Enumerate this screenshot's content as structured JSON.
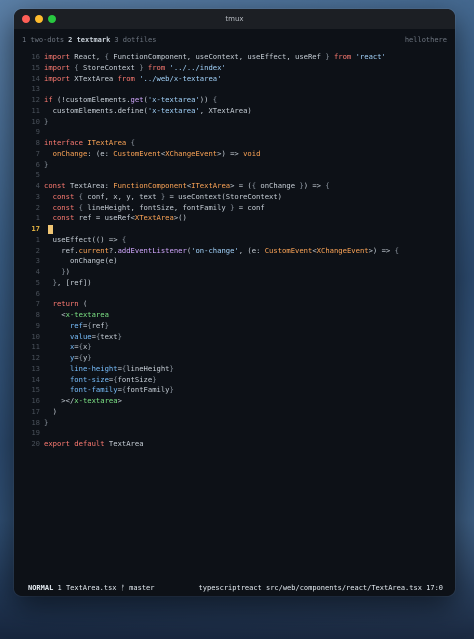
{
  "window": {
    "title": "tmux"
  },
  "tmux": {
    "tabs": [
      {
        "index": "1",
        "name": "two-dots",
        "active": false
      },
      {
        "index": "2",
        "name": "textmark",
        "active": true
      },
      {
        "index": "3",
        "name": "dotfiles",
        "active": false
      }
    ],
    "hostname": "hellothere"
  },
  "status": {
    "mode": "NORMAL",
    "buffer": "1 TextArea.tsx",
    "branch_icon": "git-branch-icon",
    "branch": "master",
    "filetype": "typescriptreact",
    "path": "src/web/components/react/TextArea.tsx",
    "position": "17:0"
  },
  "editor": {
    "current_line": 17,
    "lines": [
      {
        "n": "16",
        "html": "<span class='kw'>import</span> React, <span class='pu'>{</span> FunctionComponent, useContext, useEffect, useRef <span class='pu'>}</span> <span class='kw'>from</span> <span class='str'>'react'</span>"
      },
      {
        "n": "15",
        "html": "<span class='kw'>import</span> <span class='pu'>{</span> StoreContext <span class='pu'>}</span> <span class='kw'>from</span> <span class='str'>'../../index'</span>"
      },
      {
        "n": "14",
        "html": "<span class='kw'>import</span> XTextArea <span class='kw'>from</span> <span class='str'>'../web/x-textarea'</span>"
      },
      {
        "n": "13",
        "html": ""
      },
      {
        "n": "12",
        "html": "<span class='kw'>if</span> (!customElements.<span class='fn'>get</span>(<span class='str'>'x-textarea'</span>)) <span class='pu'>{</span>"
      },
      {
        "n": "11",
        "html": "  customElements.define(<span class='str'>'x-textarea'</span>, XTextArea)"
      },
      {
        "n": "10",
        "html": "<span class='pu'>}</span>"
      },
      {
        "n": "9",
        "html": ""
      },
      {
        "n": "8",
        "html": "<span class='kw'>interface</span> <span class='ty'>ITextArea</span> <span class='pu'>{</span>"
      },
      {
        "n": "7",
        "html": "  <span class='pr'>onChange</span>: (e: <span class='ty'>CustomEvent</span>&lt;<span class='ty'>XChangeEvent</span>&gt;) =&gt; <span class='ty'>void</span>"
      },
      {
        "n": "6",
        "html": "<span class='pu'>}</span>"
      },
      {
        "n": "5",
        "html": ""
      },
      {
        "n": "4",
        "html": "<span class='kw'>const</span> TextArea: <span class='ty'>FunctionComponent</span>&lt;<span class='ty'>ITextArea</span>&gt; = (<span class='pu'>{</span> onChange <span class='pu'>}</span>) =&gt; <span class='pu'>{</span>"
      },
      {
        "n": "3",
        "html": "  <span class='kw'>const</span> <span class='pu'>{</span> conf, x, y, text <span class='pu'>}</span> = useContext(StoreContext)"
      },
      {
        "n": "2",
        "html": "  <span class='kw'>const</span> <span class='pu'>{</span> lineHeight, fontSize, fontFamily <span class='pu'>}</span> = conf"
      },
      {
        "n": "1",
        "html": "  <span class='kw'>const</span> ref = useRef&lt;<span class='ty'>XTextArea</span>&gt;()"
      },
      {
        "n": "17",
        "html": "",
        "current": true
      },
      {
        "n": "1",
        "html": "  useEffect(() =&gt; <span class='pu'>{</span>"
      },
      {
        "n": "2",
        "html": "    ref.<span class='pr'>current</span>?.<span class='fn'>addEventListener</span>(<span class='str'>'on-change'</span>, (e: <span class='ty'>CustomEvent</span>&lt;<span class='ty'>XChangeEvent</span>&gt;) =&gt; <span class='pu'>{</span>"
      },
      {
        "n": "3",
        "html": "      onChange(e)"
      },
      {
        "n": "4",
        "html": "    <span class='pu'>}</span>)"
      },
      {
        "n": "5",
        "html": "  <span class='pu'>}</span>, [ref])"
      },
      {
        "n": "6",
        "html": ""
      },
      {
        "n": "7",
        "html": "  <span class='kw'>return</span> ("
      },
      {
        "n": "8",
        "html": "    &lt;<span class='tg'>x-textarea</span>"
      },
      {
        "n": "9",
        "html": "      <span class='at'>ref</span>=<span class='pu'>{</span>ref<span class='pu'>}</span>"
      },
      {
        "n": "10",
        "html": "      <span class='at'>value</span>=<span class='pu'>{</span>text<span class='pu'>}</span>"
      },
      {
        "n": "11",
        "html": "      <span class='at'>x</span>=<span class='pu'>{</span>x<span class='pu'>}</span>"
      },
      {
        "n": "12",
        "html": "      <span class='at'>y</span>=<span class='pu'>{</span>y<span class='pu'>}</span>"
      },
      {
        "n": "13",
        "html": "      <span class='at'>line-height</span>=<span class='pu'>{</span>lineHeight<span class='pu'>}</span>"
      },
      {
        "n": "14",
        "html": "      <span class='at'>font-size</span>=<span class='pu'>{</span>fontSize<span class='pu'>}</span>"
      },
      {
        "n": "15",
        "html": "      <span class='at'>font-family</span>=<span class='pu'>{</span>fontFamily<span class='pu'>}</span>"
      },
      {
        "n": "16",
        "html": "    &gt;&lt;/<span class='tg'>x-textarea</span>&gt;"
      },
      {
        "n": "17",
        "html": "  )"
      },
      {
        "n": "18",
        "html": "<span class='pu'>}</span>"
      },
      {
        "n": "19",
        "html": ""
      },
      {
        "n": "20",
        "html": "<span class='kw'>export</span> <span class='kw'>default</span> TextArea"
      }
    ]
  }
}
